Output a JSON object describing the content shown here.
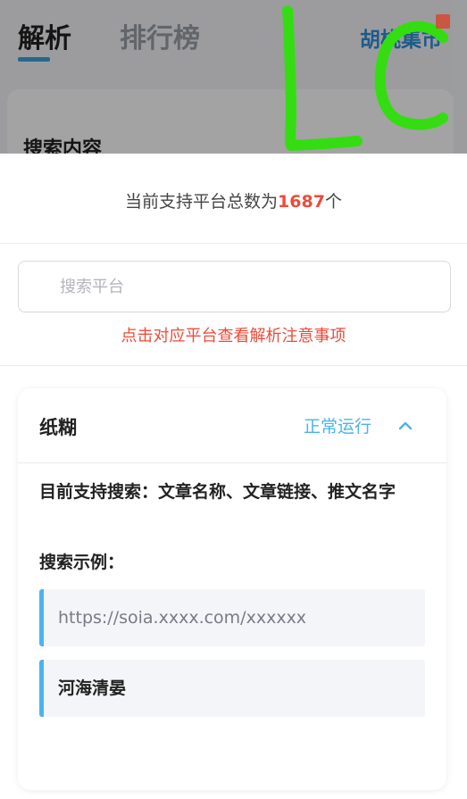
{
  "background": {
    "tabs": [
      {
        "label": "解析"
      },
      {
        "label": "排行榜"
      }
    ],
    "city": "胡桃集市",
    "card_title": "搜索内容",
    "overlay_handwriting": "LC"
  },
  "sheet": {
    "total_prefix": "当前支持平台总数为",
    "total_count": "1687",
    "total_suffix": "个",
    "search_placeholder": "搜索平台",
    "hint": "点击对应平台查看解析注意事项",
    "platform": {
      "name": "纸糊",
      "status": "正常运行",
      "support": "目前支持搜索：文章名称、文章链接、推文名字",
      "example_label": "搜索示例：",
      "examples": [
        "https://soia.xxxx.com/xxxxxx",
        "河海清晏"
      ]
    }
  },
  "colors": {
    "accent_blue": "#4ab3ef",
    "red": "#ef4a39",
    "scribble_green": "#33dd11"
  },
  "icons": {
    "chevron": "chevron-up-icon"
  }
}
